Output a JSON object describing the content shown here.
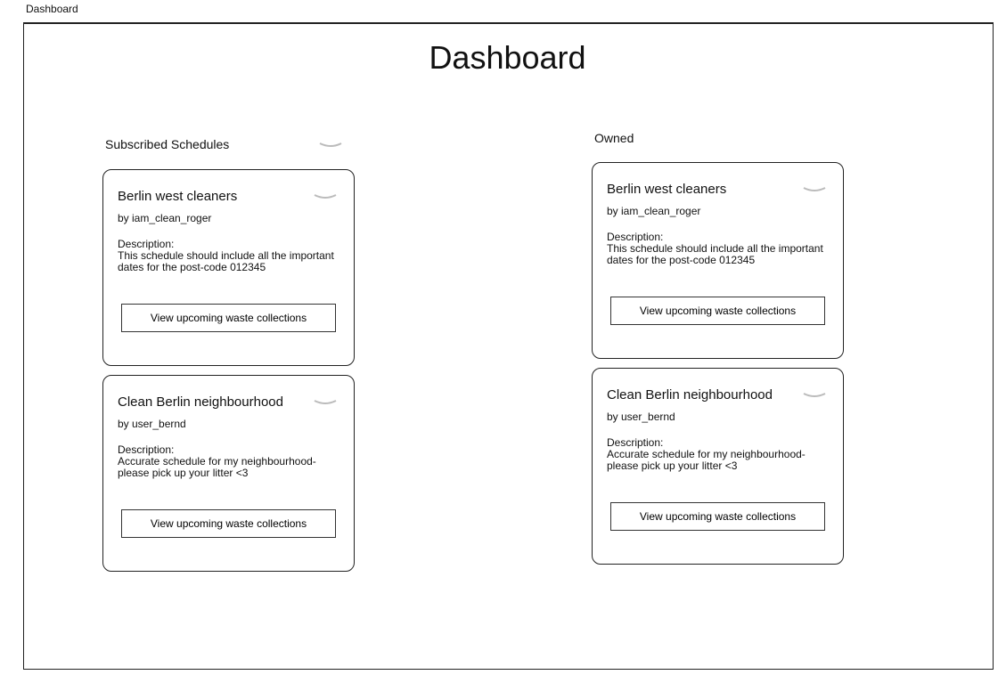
{
  "window": {
    "tab_label": "Dashboard"
  },
  "page": {
    "title": "Dashboard"
  },
  "sections": [
    {
      "heading": "Subscribed Schedules",
      "cards": [
        {
          "title": "Berlin west cleaners",
          "author": "by iam_clean_roger",
          "description_label": "Description:",
          "description": "This schedule should include all the important dates for the post-code 012345",
          "button": "View upcoming waste collections"
        },
        {
          "title": "Clean Berlin neighbourhood",
          "author": "by user_bernd",
          "description_label": "Description:",
          "description": "Accurate schedule for my neighbourhood- please pick up your litter <3",
          "button": "View upcoming waste collections"
        }
      ]
    },
    {
      "heading": "Owned",
      "cards": [
        {
          "title": "Berlin west cleaners",
          "author": "by iam_clean_roger",
          "description_label": "Description:",
          "description": "This schedule should include all the important dates for the post-code 012345",
          "button": "View upcoming waste collections"
        },
        {
          "title": "Clean Berlin neighbourhood",
          "author": "by user_bernd",
          "description_label": "Description:",
          "description": "Accurate schedule for my neighbourhood- please pick up your litter <3",
          "button": "View upcoming waste collections"
        }
      ]
    }
  ],
  "icons": {
    "collapse": "chevron-down-icon"
  },
  "colors": {
    "chevron": "#bbbbbb",
    "border": "#222222"
  }
}
